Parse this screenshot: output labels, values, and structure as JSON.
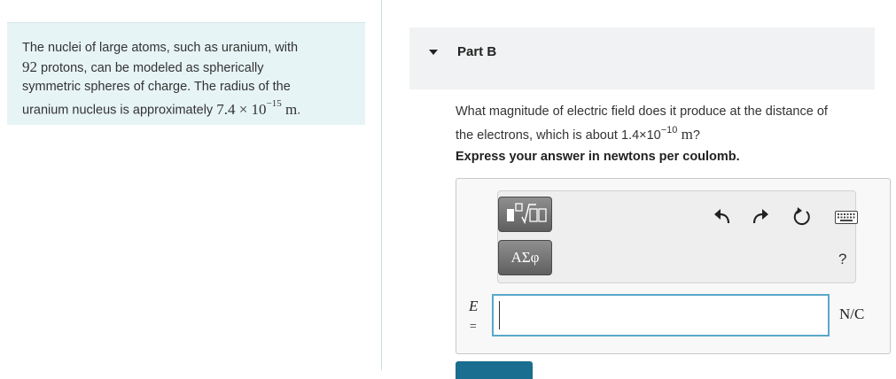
{
  "intro": {
    "line1": "The nuclei of large atoms, such as uranium, with",
    "protons_number": "92",
    "line2_rest": " protons, can be modeled as spherically",
    "line3": "symmetric spheres of charge. The radius of the",
    "line4_prefix": "uranium nucleus is approximately ",
    "radius_mantissa": "7.4 × 10",
    "radius_exponent": "−15",
    "radius_unit": " m",
    "line4_suffix": "."
  },
  "part": {
    "label": "Part B"
  },
  "question": {
    "line1": "What magnitude of electric field does it produce at the distance of",
    "line2_prefix": "the electrons, which is about 1.4×10",
    "distance_exponent": "−10",
    "distance_unit": " m",
    "line2_suffix": "?",
    "instruction": "Express your answer in newtons per coulomb."
  },
  "answer": {
    "variable": "E",
    "equals": "=",
    "value": "",
    "unit": "N/C",
    "greek_label": "ΑΣφ",
    "help_label": "?"
  },
  "icons": {
    "templates": "templates-icon",
    "greek": "greek-letters-icon",
    "undo": "undo-icon",
    "redo": "redo-icon",
    "reset": "reset-icon",
    "keyboard": "keyboard-icon",
    "help": "help-icon"
  },
  "colors": {
    "intro_bg": "#e7f4f6",
    "input_border": "#5aa8c9",
    "submit_bg": "#1a6e8f"
  }
}
